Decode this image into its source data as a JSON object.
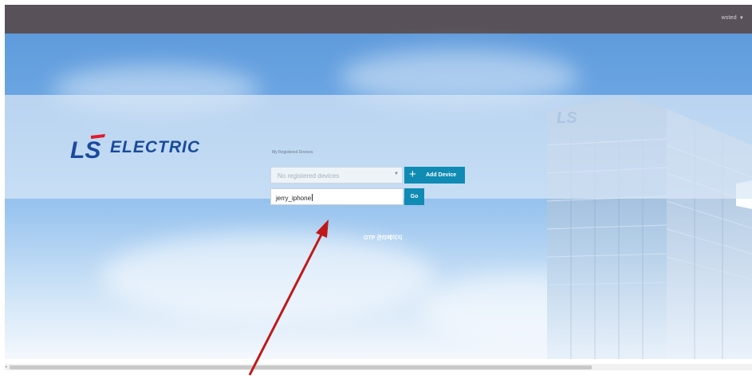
{
  "topbar": {
    "username": "wsted",
    "dropdown_icon": "caret-down-icon",
    "background": "#585159"
  },
  "logo": {
    "mark": "LS",
    "wordmark": "ELECTRIC",
    "color": "#1a4a9c",
    "accent": "#e11a2d"
  },
  "devices": {
    "section_label": "My Registered Devices",
    "select_value": "No registered devices",
    "select_icon": "caret-down-icon",
    "add_button_icon": "plus-icon",
    "add_button_label": "Add Device"
  },
  "device_name": {
    "value": "jerry_iphone",
    "go_label": "Go"
  },
  "otp_link": "OTP 관리페이지",
  "colors": {
    "primary_button": "#0f8bb4",
    "annotation_arrow": "#c01818"
  }
}
